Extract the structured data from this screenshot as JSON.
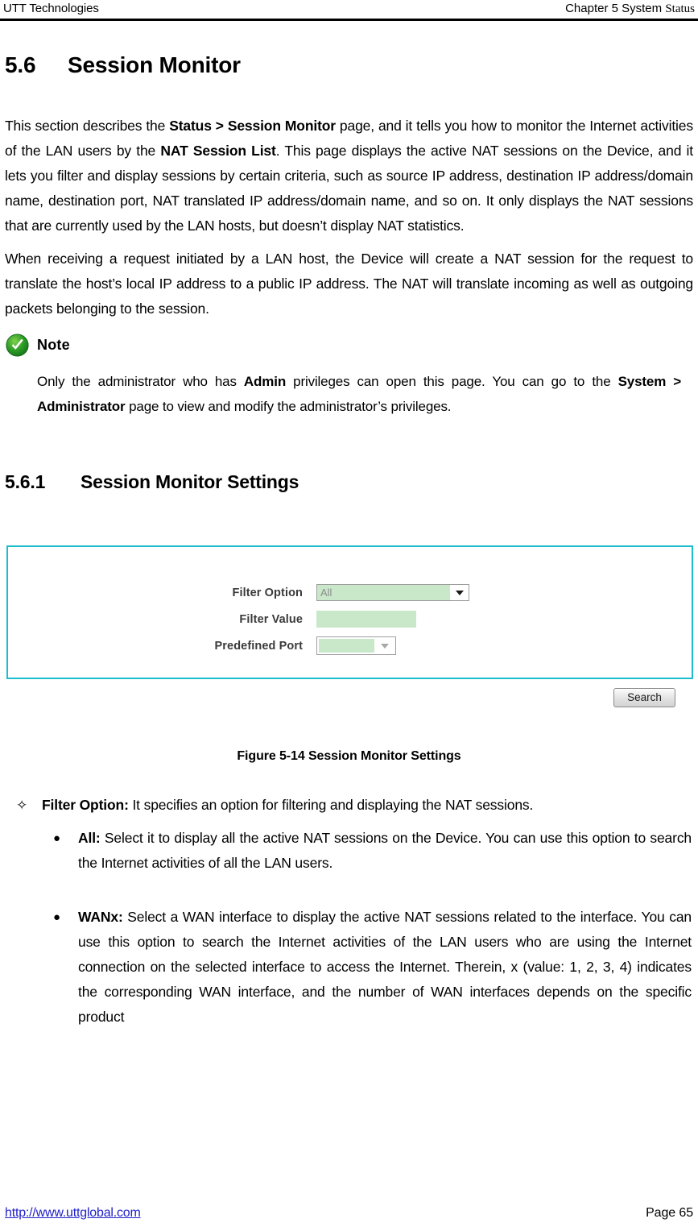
{
  "header": {
    "left": "UTT Technologies",
    "right_main": "Chapter 5 System ",
    "right_serif": "Status"
  },
  "section": {
    "number": "5.6",
    "title": "Session Monitor"
  },
  "intro": {
    "p1_a": "This section describes the ",
    "p1_b1": "Status > Session Monitor",
    "p1_c": " page, and it tells you how to monitor the Internet activities of the LAN users by the ",
    "p1_b2": "NAT Session List",
    "p1_d": ". This page displays the active NAT sessions on the Device, and it lets you filter and display sessions by certain criteria, such as source IP address, destination IP address/domain name, destination port, NAT translated IP address/domain name, and so on. It only displays the NAT sessions that are currently used by the LAN hosts, but doesn’t display NAT statistics.",
    "p2": "When receiving a request initiated by a LAN host, the Device will create a NAT session for the request to translate the host’s local IP address to a public IP address. The NAT will translate incoming as well as outgoing packets belonging to the session."
  },
  "note": {
    "label": "Note",
    "body_a": "Only the administrator who has ",
    "body_b1": "Admin",
    "body_c": " privileges can open this page. You can go to the ",
    "body_b2": "System > Administrator",
    "body_d": " page to view and modify the administrator’s privileges."
  },
  "subsection": {
    "number": "5.6.1",
    "title": "Session Monitor Settings"
  },
  "figure": {
    "caption": "Figure 5-14 Session Monitor Settings",
    "border_color": "#1cbecd",
    "field_fill": "#c9e8c9",
    "rows": [
      {
        "label": "Filter Option",
        "value": "All",
        "control": "select-large"
      },
      {
        "label": "Filter Value",
        "value": "",
        "control": "text-input"
      },
      {
        "label": "Predefined Port",
        "value": "",
        "control": "select-small"
      }
    ],
    "search_button": "Search"
  },
  "bullets": {
    "lvl1_marker": "✧",
    "lvl2_marker": "●",
    "filter_option": {
      "term": "Filter Option:",
      "text": " It specifies an option for filtering and displaying the NAT sessions."
    },
    "all": {
      "term": "All:",
      "text": " Select it to display all the active NAT sessions on the Device. You can use this option to search the Internet activities of all the LAN users."
    },
    "wanx": {
      "term": "WANx:",
      "text": " Select a WAN interface to display the active NAT sessions related to the interface. You can use this option to search the Internet activities of the LAN users who are using the Internet connection on the selected interface to access the Internet. Therein, x (value: 1, 2, 3, 4) indicates the corresponding WAN interface, and the number of WAN interfaces depends on the specific product"
    }
  },
  "footer": {
    "url": "http://www.uttglobal.com",
    "page": "Page 65"
  }
}
